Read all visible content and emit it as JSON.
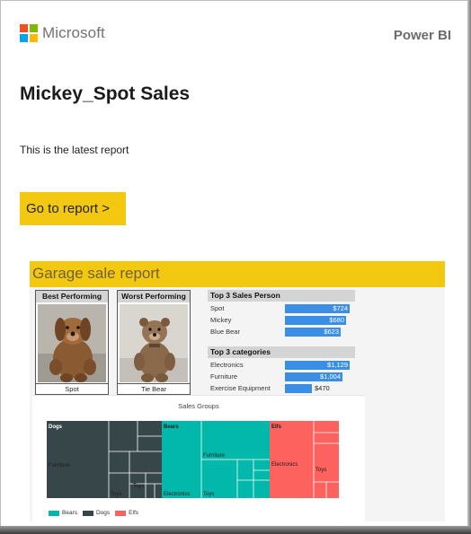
{
  "brand": {
    "name": "Microsoft",
    "logo_colors": [
      "#f25022",
      "#7fba00",
      "#00a4ef",
      "#ffb900"
    ],
    "product": "Power BI"
  },
  "email": {
    "title": "Mickey_Spot Sales",
    "body": "This is the latest report",
    "button_label": "Go to report >",
    "accent": "#f2c811"
  },
  "report": {
    "title": "Garage sale report",
    "best": {
      "heading": "Best Performing",
      "name": "Spot"
    },
    "worst": {
      "heading": "Worst Performing",
      "name": "Tie Bear"
    },
    "sales_person": {
      "heading": "Top 3 Sales Person",
      "rows": [
        {
          "label": "Spot",
          "value": 724,
          "text": "$724"
        },
        {
          "label": "Mickey",
          "value": 680,
          "text": "$680"
        },
        {
          "label": "Blue Bear",
          "value": 623,
          "text": "$623"
        }
      ]
    },
    "categories": {
      "heading": "Top 3 categories",
      "rows": [
        {
          "label": "Electronics",
          "value": 1129,
          "text": "$1,129"
        },
        {
          "label": "Furniture",
          "value": 1004,
          "text": "$1,004"
        },
        {
          "label": "Exercise Equipment",
          "value": 470,
          "text": "$470"
        }
      ]
    },
    "treemap": {
      "title": "Sales Groups",
      "groups": [
        {
          "name": "Dogs",
          "color": "#374649",
          "labels": [
            "Furniture",
            "Toys",
            "Toys"
          ]
        },
        {
          "name": "Bears",
          "color": "#01b8aa",
          "labels": [
            "Furniture",
            "Electronics",
            "Toys"
          ]
        },
        {
          "name": "Elfs",
          "color": "#fd625e",
          "labels": [
            "Electronics",
            "Toys"
          ]
        }
      ],
      "legend": [
        {
          "name": "Bears",
          "color": "#01b8aa"
        },
        {
          "name": "Dogs",
          "color": "#374649"
        },
        {
          "name": "Elfs",
          "color": "#fd625e"
        }
      ]
    },
    "bar_color": "#3b8ee6"
  },
  "chart_data": [
    {
      "type": "bar",
      "title": "Top 3 Sales Person",
      "categories": [
        "Spot",
        "Mickey",
        "Blue Bear"
      ],
      "values": [
        724,
        680,
        623
      ]
    },
    {
      "type": "bar",
      "title": "Top 3 categories",
      "categories": [
        "Electronics",
        "Furniture",
        "Exercise Equipment"
      ],
      "values": [
        1129,
        1004,
        470
      ]
    }
  ]
}
